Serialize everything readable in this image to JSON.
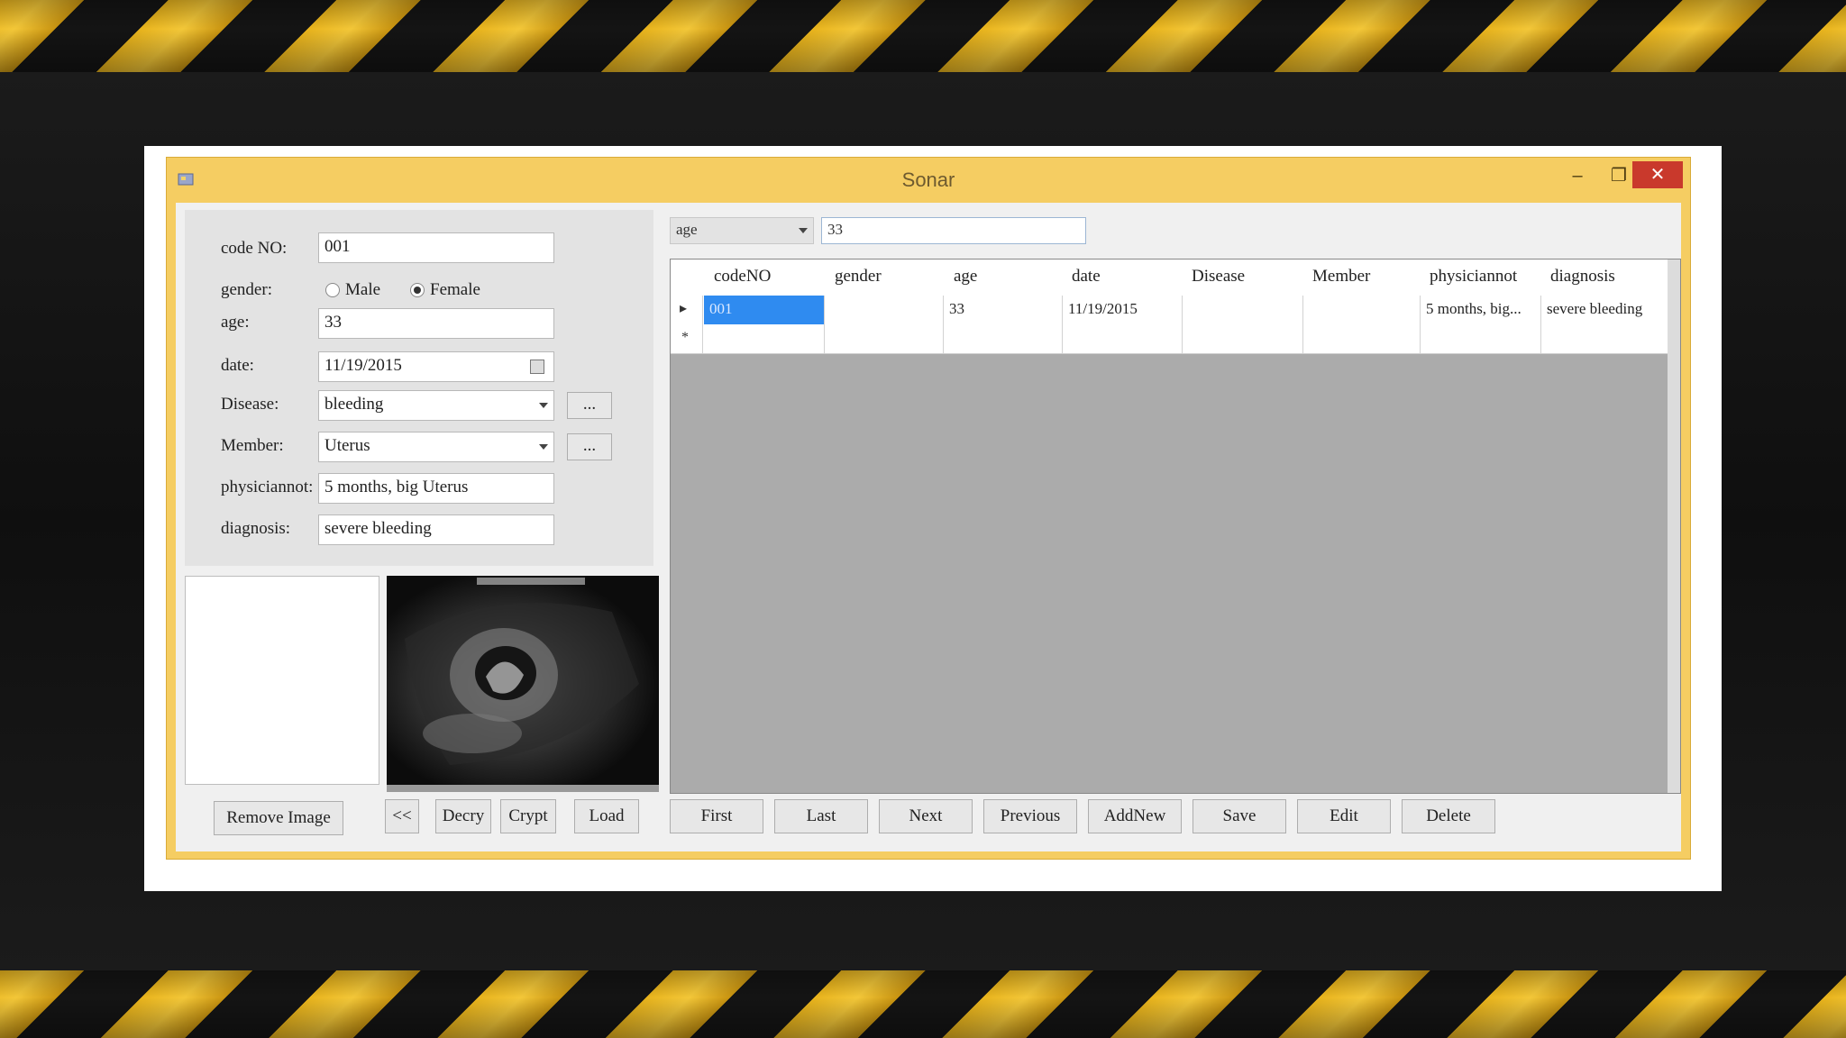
{
  "window": {
    "title": "Sonar",
    "minimize": "–",
    "maximize": "❐",
    "close": "✕"
  },
  "form": {
    "code_label": "code NO:",
    "code_value": "001",
    "gender_label": "gender:",
    "male_label": "Male",
    "female_label": "Female",
    "gender_selected": "Female",
    "age_label": "age:",
    "age_value": "33",
    "date_label": "date:",
    "date_value": "11/19/2015",
    "disease_label": "Disease:",
    "disease_value": "bleeding",
    "disease_more": "...",
    "member_label": "Member:",
    "member_value": "Uterus",
    "member_more": "...",
    "physician_label": "physiciannot:",
    "physician_value": "5 months, big Uterus",
    "diagnosis_label": "diagnosis:",
    "diagnosis_value": "severe bleeding"
  },
  "image_buttons": {
    "remove": "Remove Image",
    "prev": "<<",
    "decry": "Decry",
    "crypt": "Crypt",
    "load": "Load"
  },
  "nav_buttons": {
    "first": "First",
    "last": "Last",
    "next": "Next",
    "previous": "Previous",
    "addnew": "AddNew",
    "save": "Save",
    "edit": "Edit",
    "delete": "Delete"
  },
  "search": {
    "field": "age",
    "value": "33"
  },
  "grid": {
    "columns": [
      "codeNO",
      "gender",
      "age",
      "date",
      "Disease",
      "Member",
      "physiciannot",
      "diagnosis"
    ],
    "rows": [
      [
        "001",
        "",
        "33",
        "11/19/2015",
        "",
        "",
        "5 months, big...",
        "severe bleeding"
      ]
    ],
    "new_row_marker": "*",
    "current_row_marker": "▸"
  },
  "colors": {
    "title_bar": "#f5cd62",
    "close_button": "#c9392c",
    "selection": "#2f8bf0",
    "grid_background": "#ababab"
  }
}
